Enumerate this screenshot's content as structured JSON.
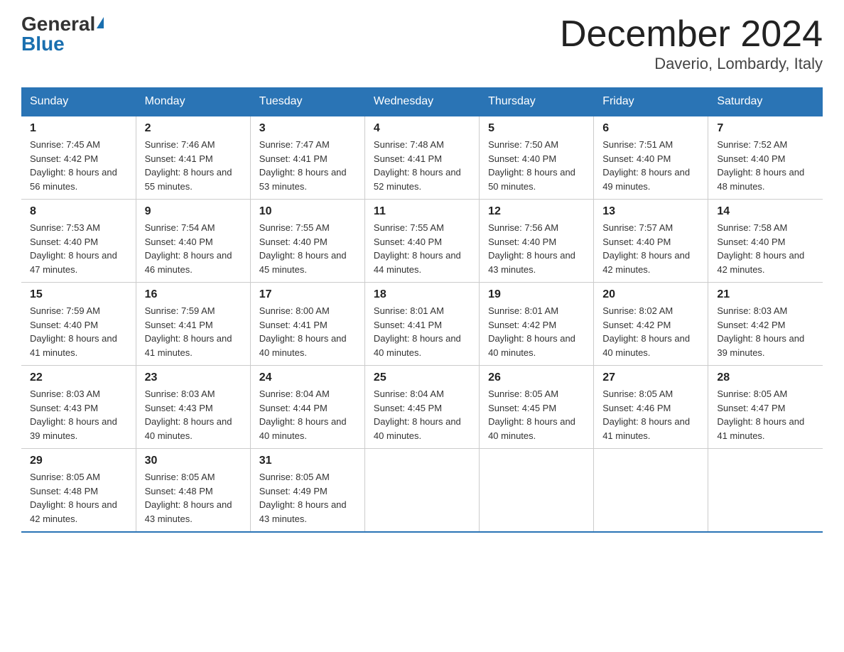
{
  "logo": {
    "general": "General",
    "blue": "Blue"
  },
  "title": "December 2024",
  "subtitle": "Daverio, Lombardy, Italy",
  "days": [
    "Sunday",
    "Monday",
    "Tuesday",
    "Wednesday",
    "Thursday",
    "Friday",
    "Saturday"
  ],
  "weeks": [
    [
      {
        "num": "1",
        "sunrise": "7:45 AM",
        "sunset": "4:42 PM",
        "daylight": "8 hours and 56 minutes."
      },
      {
        "num": "2",
        "sunrise": "7:46 AM",
        "sunset": "4:41 PM",
        "daylight": "8 hours and 55 minutes."
      },
      {
        "num": "3",
        "sunrise": "7:47 AM",
        "sunset": "4:41 PM",
        "daylight": "8 hours and 53 minutes."
      },
      {
        "num": "4",
        "sunrise": "7:48 AM",
        "sunset": "4:41 PM",
        "daylight": "8 hours and 52 minutes."
      },
      {
        "num": "5",
        "sunrise": "7:50 AM",
        "sunset": "4:40 PM",
        "daylight": "8 hours and 50 minutes."
      },
      {
        "num": "6",
        "sunrise": "7:51 AM",
        "sunset": "4:40 PM",
        "daylight": "8 hours and 49 minutes."
      },
      {
        "num": "7",
        "sunrise": "7:52 AM",
        "sunset": "4:40 PM",
        "daylight": "8 hours and 48 minutes."
      }
    ],
    [
      {
        "num": "8",
        "sunrise": "7:53 AM",
        "sunset": "4:40 PM",
        "daylight": "8 hours and 47 minutes."
      },
      {
        "num": "9",
        "sunrise": "7:54 AM",
        "sunset": "4:40 PM",
        "daylight": "8 hours and 46 minutes."
      },
      {
        "num": "10",
        "sunrise": "7:55 AM",
        "sunset": "4:40 PM",
        "daylight": "8 hours and 45 minutes."
      },
      {
        "num": "11",
        "sunrise": "7:55 AM",
        "sunset": "4:40 PM",
        "daylight": "8 hours and 44 minutes."
      },
      {
        "num": "12",
        "sunrise": "7:56 AM",
        "sunset": "4:40 PM",
        "daylight": "8 hours and 43 minutes."
      },
      {
        "num": "13",
        "sunrise": "7:57 AM",
        "sunset": "4:40 PM",
        "daylight": "8 hours and 42 minutes."
      },
      {
        "num": "14",
        "sunrise": "7:58 AM",
        "sunset": "4:40 PM",
        "daylight": "8 hours and 42 minutes."
      }
    ],
    [
      {
        "num": "15",
        "sunrise": "7:59 AM",
        "sunset": "4:40 PM",
        "daylight": "8 hours and 41 minutes."
      },
      {
        "num": "16",
        "sunrise": "7:59 AM",
        "sunset": "4:41 PM",
        "daylight": "8 hours and 41 minutes."
      },
      {
        "num": "17",
        "sunrise": "8:00 AM",
        "sunset": "4:41 PM",
        "daylight": "8 hours and 40 minutes."
      },
      {
        "num": "18",
        "sunrise": "8:01 AM",
        "sunset": "4:41 PM",
        "daylight": "8 hours and 40 minutes."
      },
      {
        "num": "19",
        "sunrise": "8:01 AM",
        "sunset": "4:42 PM",
        "daylight": "8 hours and 40 minutes."
      },
      {
        "num": "20",
        "sunrise": "8:02 AM",
        "sunset": "4:42 PM",
        "daylight": "8 hours and 40 minutes."
      },
      {
        "num": "21",
        "sunrise": "8:03 AM",
        "sunset": "4:42 PM",
        "daylight": "8 hours and 39 minutes."
      }
    ],
    [
      {
        "num": "22",
        "sunrise": "8:03 AM",
        "sunset": "4:43 PM",
        "daylight": "8 hours and 39 minutes."
      },
      {
        "num": "23",
        "sunrise": "8:03 AM",
        "sunset": "4:43 PM",
        "daylight": "8 hours and 40 minutes."
      },
      {
        "num": "24",
        "sunrise": "8:04 AM",
        "sunset": "4:44 PM",
        "daylight": "8 hours and 40 minutes."
      },
      {
        "num": "25",
        "sunrise": "8:04 AM",
        "sunset": "4:45 PM",
        "daylight": "8 hours and 40 minutes."
      },
      {
        "num": "26",
        "sunrise": "8:05 AM",
        "sunset": "4:45 PM",
        "daylight": "8 hours and 40 minutes."
      },
      {
        "num": "27",
        "sunrise": "8:05 AM",
        "sunset": "4:46 PM",
        "daylight": "8 hours and 41 minutes."
      },
      {
        "num": "28",
        "sunrise": "8:05 AM",
        "sunset": "4:47 PM",
        "daylight": "8 hours and 41 minutes."
      }
    ],
    [
      {
        "num": "29",
        "sunrise": "8:05 AM",
        "sunset": "4:48 PM",
        "daylight": "8 hours and 42 minutes."
      },
      {
        "num": "30",
        "sunrise": "8:05 AM",
        "sunset": "4:48 PM",
        "daylight": "8 hours and 43 minutes."
      },
      {
        "num": "31",
        "sunrise": "8:05 AM",
        "sunset": "4:49 PM",
        "daylight": "8 hours and 43 minutes."
      },
      null,
      null,
      null,
      null
    ]
  ]
}
